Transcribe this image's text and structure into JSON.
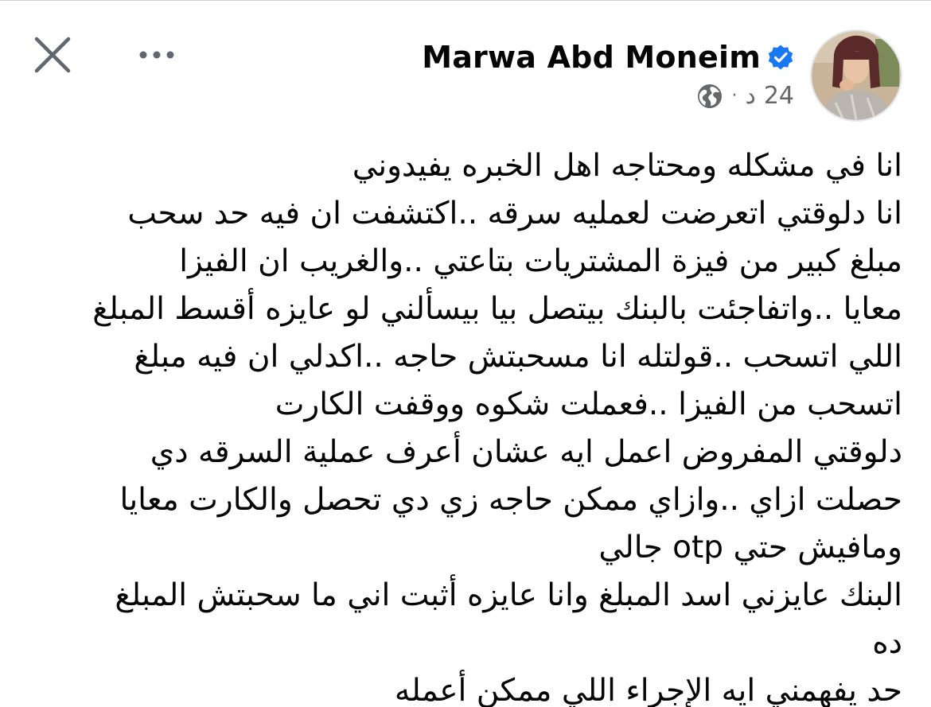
{
  "header": {
    "author_name": "Marwa Abd Moneim",
    "time_number": "24",
    "time_unit": "د",
    "separator": "·"
  },
  "icons": {
    "close": "close-icon",
    "more": "more-dots-icon",
    "verified": "verified-badge-icon",
    "privacy": "globe-icon",
    "avatar": "profile-photo"
  },
  "colors": {
    "verified_blue": "#1877f2",
    "meta_gray": "#65676b",
    "text": "#050505"
  },
  "post": {
    "lines": [
      "انا في مشكله ومحتاجه اهل الخبره يفيدوني",
      "انا دلوقتي اتعرضت لعمليه سرقه ..اكتشفت ان فيه حد سحب",
      "مبلغ كبير من فيزة المشتريات بتاعتي ..والغريب ان الفيزا",
      "معايا ..واتفاجئت بالبنك بيتصل بيا بيسألني لو عايزه أقسط المبلغ",
      "اللي اتسحب ..قولتله انا مسحبتش حاجه ..اكدلي ان فيه مبلغ",
      "اتسحب من الفيزا ..فعملت شكوه ووقفت الكارت",
      "دلوقتي المفروض اعمل ايه عشان أعرف عملية السرقه دي",
      "حصلت ازاي ..وازاي ممكن حاجه زي دي تحصل والكارت معايا",
      "ومافيش حتي otp جالي",
      "البنك عايزني اسد المبلغ وانا عايزه أثبت اني ما سحبتش المبلغ",
      "ده",
      "حد يفهمني ايه الإجراء اللي ممكن أعمله"
    ]
  }
}
